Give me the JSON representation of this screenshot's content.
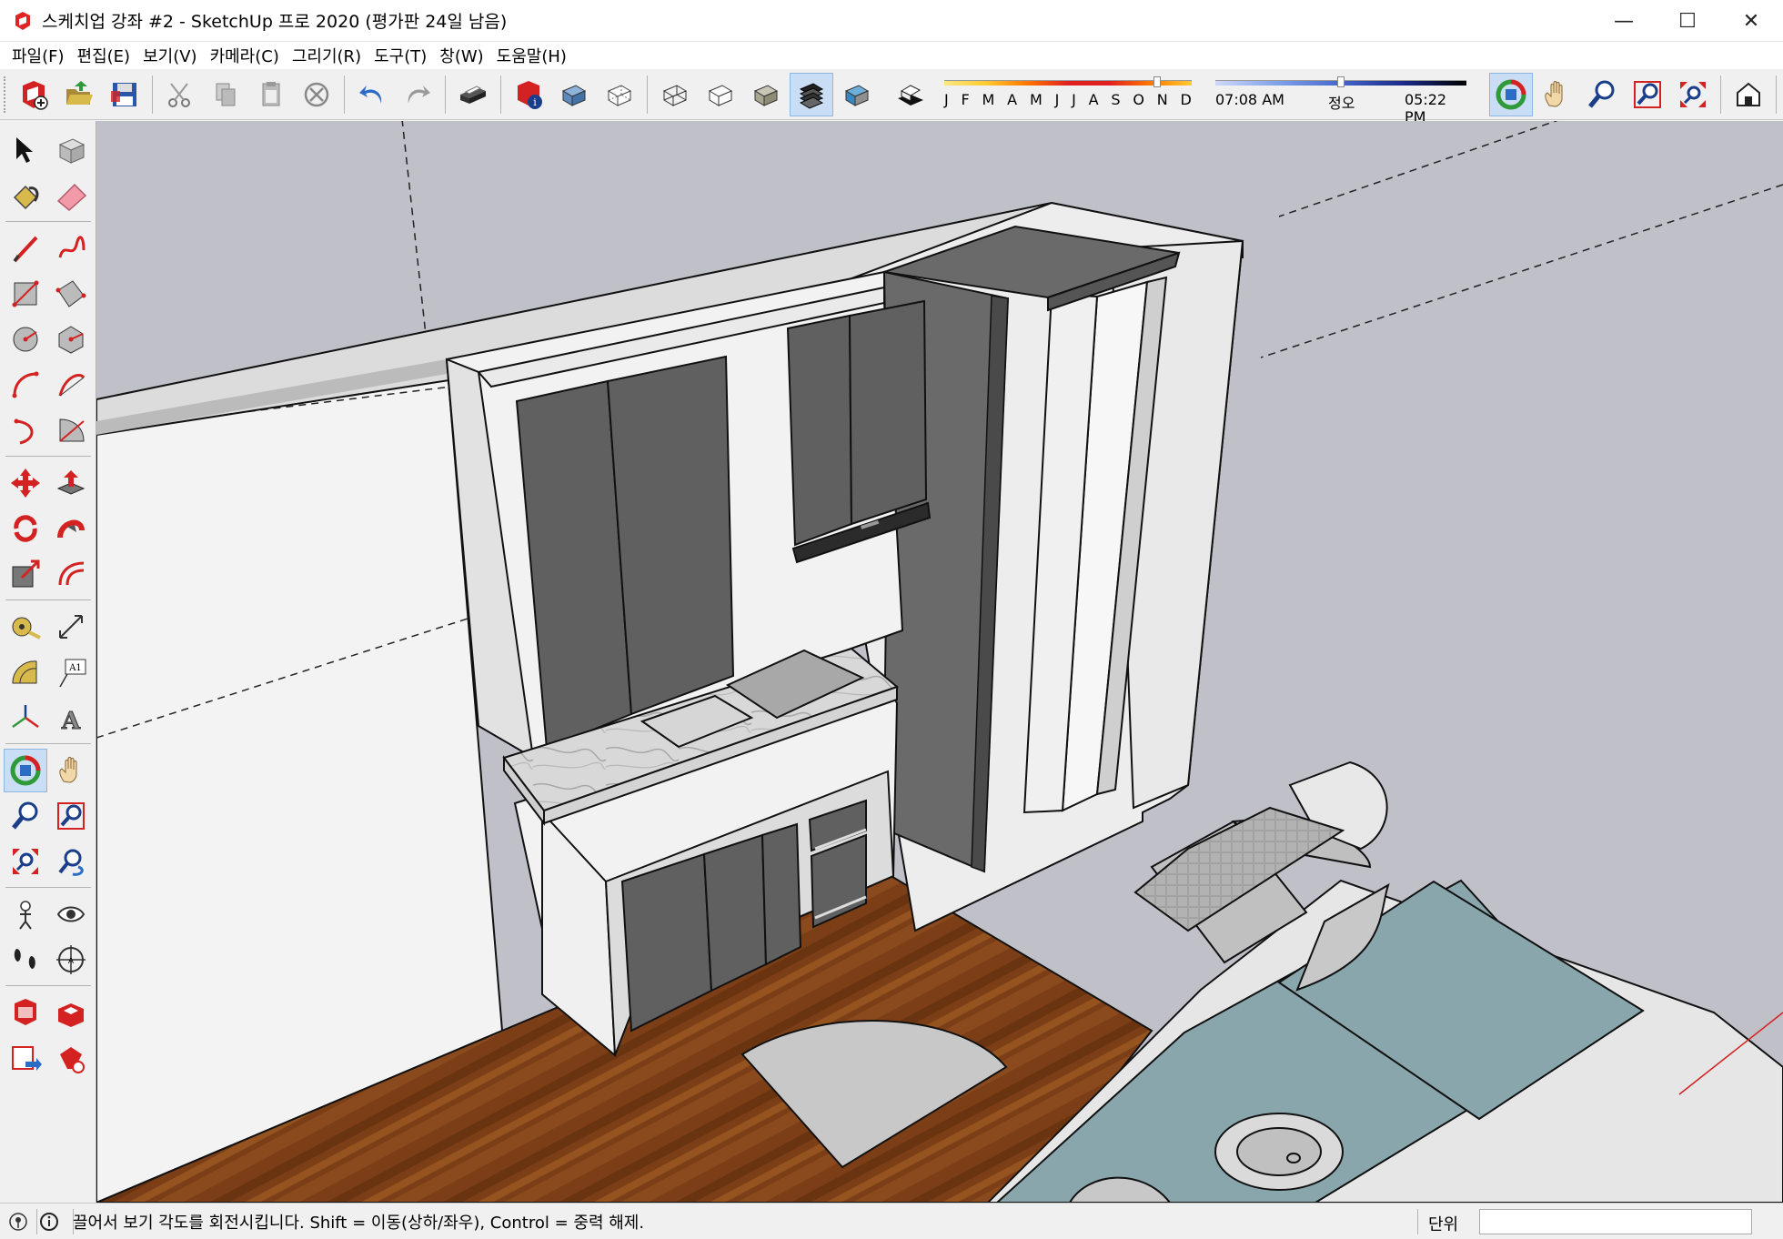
{
  "window": {
    "title": "스케치업 강좌 #2 - SketchUp 프로 2020 (평가판 24일 남음)",
    "minimize_glyph": "—",
    "maximize_glyph": "☐",
    "close_glyph": "✕"
  },
  "menu": {
    "items": [
      {
        "label": "파일(F)"
      },
      {
        "label": "편집(E)"
      },
      {
        "label": "보기(V)"
      },
      {
        "label": "카메라(C)"
      },
      {
        "label": "그리기(R)"
      },
      {
        "label": "도구(T)"
      },
      {
        "label": "창(W)"
      },
      {
        "label": "도움말(H)"
      }
    ]
  },
  "toolbar": {
    "buttons": [
      "new-model-icon",
      "open-folder-icon",
      "save-icon",
      "cut-icon",
      "copy-icon",
      "paste-icon",
      "erase-icon",
      "undo-icon",
      "redo-icon",
      "print-icon",
      "model-info-icon",
      "xray-icon",
      "back-edges-icon",
      "wireframe-icon",
      "hidden-line-icon",
      "shaded-icon",
      "shaded-textures-icon",
      "monochrome-icon",
      "shadows-toggle-icon",
      "orbit-icon",
      "pan-icon",
      "zoom-icon",
      "zoom-window-icon",
      "zoom-extents-icon",
      "warehouse-icon",
      "position-camera-icon"
    ],
    "shadow_months": [
      "J",
      "F",
      "M",
      "A",
      "M",
      "J",
      "J",
      "A",
      "S",
      "O",
      "N",
      "D"
    ],
    "shadow_month_value": 0.86,
    "time_start": "07:08 AM",
    "time_noon": "정오",
    "time_end": "05:22 PM",
    "time_value": 0.5
  },
  "left_tools": [
    "select-icon",
    "component-icon",
    "paint-bucket-icon",
    "eraser-icon",
    "line-icon",
    "freehand-icon",
    "rectangle-icon",
    "rotated-rectangle-icon",
    "circle-icon",
    "polygon-icon",
    "arc-icon",
    "two-point-arc-icon",
    "three-point-arc-icon",
    "pie-icon",
    "move-icon",
    "push-pull-icon",
    "rotate-icon",
    "follow-me-icon",
    "scale-icon",
    "offset-icon",
    "tape-measure-icon",
    "dimension-icon",
    "protractor-icon",
    "text-icon",
    "axes-icon",
    "3d-text-icon",
    "orbit-icon",
    "pan-icon",
    "zoom-icon",
    "zoom-window-icon",
    "zoom-extents-icon",
    "previous-view-icon",
    "position-camera-icon",
    "look-around-icon",
    "walk-icon",
    "section-plane-icon",
    "warehouse-icon",
    "extension-warehouse-icon",
    "send-to-layout-icon",
    "extension-manager-icon"
  ],
  "status": {
    "hint": "끌어서 보기 각도를 회전시킵니다. Shift = 이동(상하/좌우), Control = 중력 해제.",
    "measurements_label": "단위",
    "measurements_value": ""
  },
  "colors": {
    "viewport_bg": "#bfc0c8",
    "cabinet_door": "#606060",
    "cabinet_body": "#f2f2f2",
    "floor_wood": "#7a3f18",
    "bath_tile": "#87a6ab",
    "active_blue": "#c9def5"
  }
}
